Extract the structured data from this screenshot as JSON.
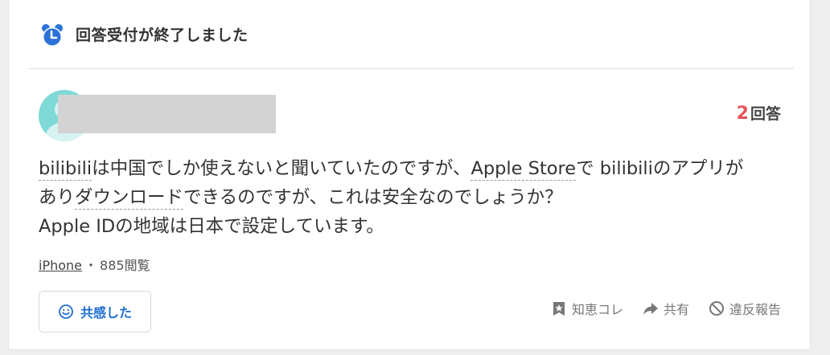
{
  "status": {
    "icon": "alarm-clock-icon",
    "text": "回答受付が終了しました",
    "icon_color": "#2b73d8"
  },
  "question": {
    "answer_count": "2",
    "answer_label": "回答",
    "answer_count_color": "#e8535b",
    "lines": [
      {
        "segments": [
          {
            "text": "bilibili",
            "keyword": true
          },
          {
            "text": "は中国でしか使えないと聞いていたのですが、",
            "keyword": false
          },
          {
            "text": "Apple Store",
            "keyword": true
          },
          {
            "text": "で bilibiliのアプリが",
            "keyword": false
          }
        ]
      },
      {
        "segments": [
          {
            "text": "あり",
            "keyword": false
          },
          {
            "text": "ダウンロード",
            "keyword": true
          },
          {
            "text": "できるのですが、これは安全なのでしょうか？",
            "keyword": false
          }
        ]
      },
      {
        "segments": [
          {
            "text": "Apple IDの地域は日本で設定しています。",
            "keyword": false
          }
        ]
      }
    ]
  },
  "meta": {
    "tag": "iPhone",
    "separator": "・",
    "views": "885閲覧"
  },
  "empathy_button": {
    "icon": "smile-icon",
    "label": "共感した",
    "color": "#1e6fd1"
  },
  "actions": [
    {
      "icon": "bookmark-star-icon",
      "label": "知恵コレ"
    },
    {
      "icon": "share-arrow-icon",
      "label": "共有"
    },
    {
      "icon": "prohibited-icon",
      "label": "違反報告"
    }
  ]
}
